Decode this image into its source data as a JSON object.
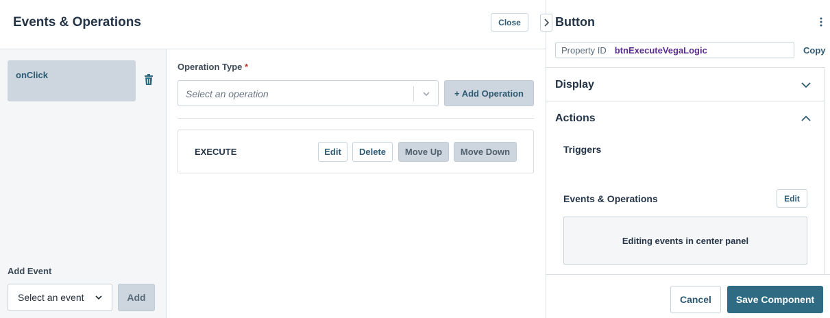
{
  "main": {
    "title": "Events & Operations",
    "close_label": "Close"
  },
  "events": {
    "items": [
      {
        "label": "onClick"
      }
    ],
    "add_event_label": "Add Event",
    "event_select_value": "Select an event",
    "add_button_label": "Add"
  },
  "operations": {
    "type_label": "Operation Type",
    "required_mark": "*",
    "select_placeholder": "Select an operation",
    "add_operation_label": "+ Add Operation",
    "items": [
      {
        "name": "EXECUTE",
        "edit_label": "Edit",
        "delete_label": "Delete",
        "move_up_label": "Move Up",
        "move_down_label": "Move Down"
      }
    ]
  },
  "side": {
    "title": "Button",
    "property_id_label": "Property ID",
    "property_id_value": "btnExecuteVegaLogic",
    "copy_label": "Copy",
    "sections": [
      {
        "title": "Display",
        "expanded": false
      },
      {
        "title": "Actions",
        "expanded": true
      }
    ],
    "triggers_label": "Triggers",
    "events_ops_label": "Events & Operations",
    "events_ops_edit_label": "Edit",
    "events_ops_status": "Editing events in center panel",
    "cancel_label": "Cancel",
    "save_label": "Save Component"
  },
  "colors": {
    "accent": "#2f6b83",
    "link": "#2f5a73",
    "property_value": "#5b2d8e",
    "selected_bg": "#cdd6de"
  },
  "icons": [
    "trash-icon",
    "chevron-down-icon",
    "chevron-right-icon",
    "chevron-up-icon",
    "kebab-menu-icon"
  ]
}
